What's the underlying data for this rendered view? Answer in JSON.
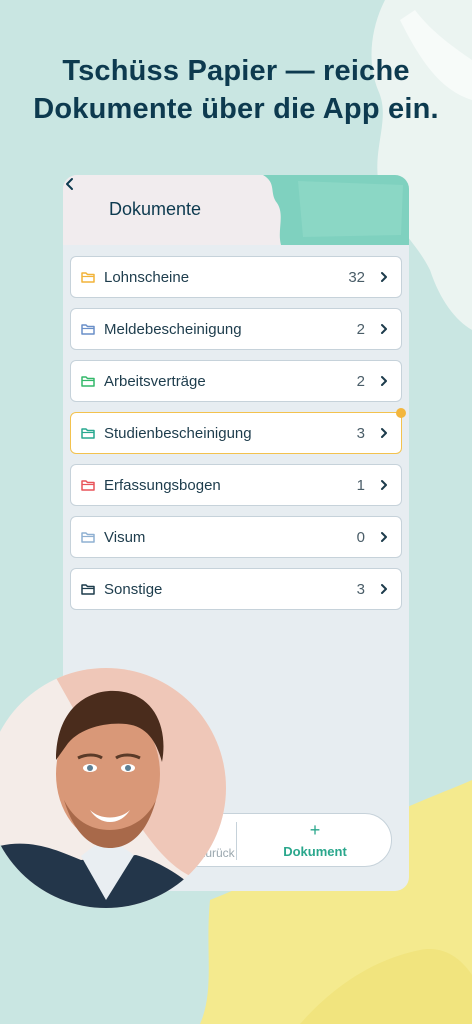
{
  "headline": {
    "line1": "Tschüss Papier — reiche",
    "line2": "Dokumente über die App ein."
  },
  "header": {
    "title": "Dokumente",
    "back_icon": "chevron-left-icon"
  },
  "folders": [
    {
      "label": "Lohnscheine",
      "count": "32",
      "color": "#f2b43a"
    },
    {
      "label": "Meldebescheinigung",
      "count": "2",
      "color": "#6a8fc8"
    },
    {
      "label": "Arbeitsverträge",
      "count": "2",
      "color": "#33b86a"
    },
    {
      "label": "Studienbescheinigung",
      "count": "3",
      "color": "#27a88f"
    },
    {
      "label": "Erfassungsbogen",
      "count": "1",
      "color": "#e8545a"
    },
    {
      "label": "Visum",
      "count": "0",
      "color": "#8fb0d2"
    },
    {
      "label": "Sonstige",
      "count": "3",
      "color": "#1d3c4c"
    }
  ],
  "bottom": {
    "back_label": "Zurück",
    "add_label": "Dokument",
    "add_symbol": "+"
  },
  "colors": {
    "background": "#c9e6e2",
    "accent": "#2aa78c",
    "highlight": "#f3c24e",
    "text_dark": "#0d3a4f"
  }
}
